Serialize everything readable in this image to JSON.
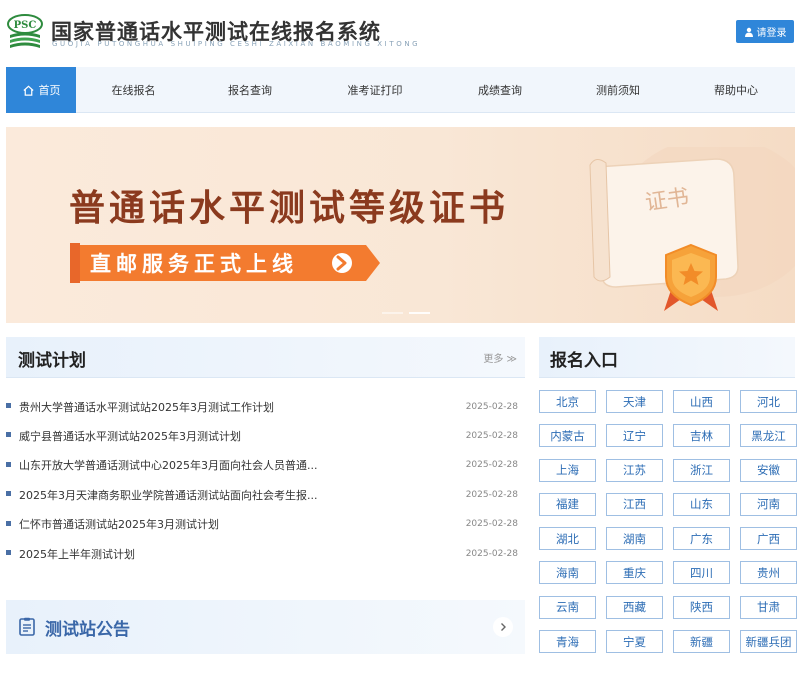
{
  "header": {
    "logo_text": "PSC",
    "title": "国家普通话水平测试在线报名系统",
    "subtitle": "GUOJIA PUTONGHUA SHUIPING CESHI ZAIXIAN BAOMING XITONG",
    "login_label": "请登录",
    "accent_color": "#2f86d9"
  },
  "nav": {
    "items": [
      {
        "label": "首页",
        "active": true,
        "icon": "home-icon"
      },
      {
        "label": "在线报名"
      },
      {
        "label": "报名查询"
      },
      {
        "label": "准考证打印"
      },
      {
        "label": "成绩查询"
      },
      {
        "label": "测前须知"
      },
      {
        "label": "帮助中心"
      }
    ]
  },
  "banner": {
    "title": "普通话水平测试等级证书",
    "ribbon_text": "直邮服务正式上线",
    "scroll_text": "证书"
  },
  "plan": {
    "title": "测试计划",
    "more_label": "更多 ≫",
    "items": [
      {
        "text": "贵州大学普通话水平测试站2025年3月测试工作计划",
        "date": "2025-02-28"
      },
      {
        "text": "威宁县普通话水平测试站2025年3月测试计划",
        "date": "2025-02-28"
      },
      {
        "text": "山东开放大学普通话测试中心2025年3月面向社会人员普通...",
        "date": "2025-02-28"
      },
      {
        "text": "2025年3月天津商务职业学院普通话测试站面向社会考生报...",
        "date": "2025-02-28"
      },
      {
        "text": "仁怀市普通话测试站2025年3月测试计划",
        "date": "2025-02-28"
      },
      {
        "text": "2025年上半年测试计划",
        "date": "2025-02-28"
      }
    ]
  },
  "notice": {
    "title": "测试站公告",
    "icon": "document-icon"
  },
  "registration": {
    "title": "报名入口",
    "regions": [
      "北京",
      "天津",
      "山西",
      "河北",
      "内蒙古",
      "辽宁",
      "吉林",
      "黑龙江",
      "上海",
      "江苏",
      "浙江",
      "安徽",
      "福建",
      "江西",
      "山东",
      "河南",
      "湖北",
      "湖南",
      "广东",
      "广西",
      "海南",
      "重庆",
      "四川",
      "贵州",
      "云南",
      "西藏",
      "陕西",
      "甘肃",
      "青海",
      "宁夏",
      "新疆",
      "新疆兵团"
    ]
  }
}
